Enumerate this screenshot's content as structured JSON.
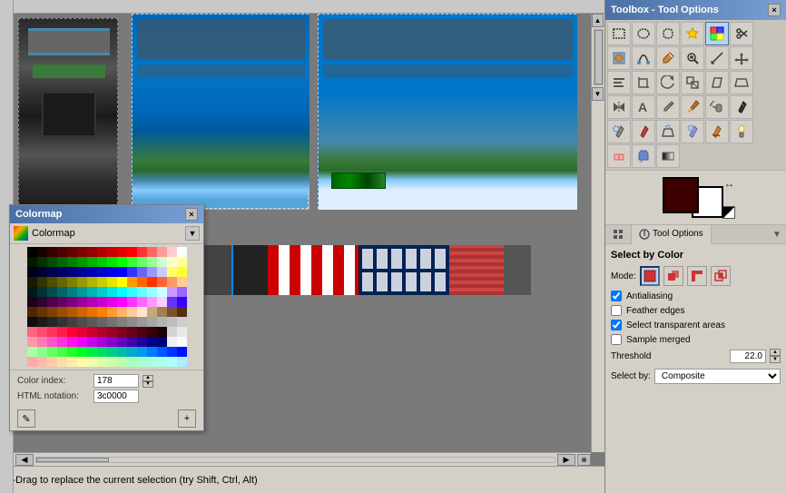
{
  "toolbox": {
    "title": "Toolbox - Tool Options",
    "close_label": "×"
  },
  "colormap": {
    "title": "Colormap",
    "label": "Colormap",
    "close_label": "×",
    "color_index_label": "Color index:",
    "color_index_value": "178",
    "html_notation_label": "HTML notation:",
    "html_notation_value": "3c0000"
  },
  "tool_options": {
    "section_title": "Select by Color",
    "mode_label": "Mode:",
    "antialiasing_label": "Antialiasing",
    "antialiasing_checked": true,
    "feather_edges_label": "Feather edges",
    "feather_edges_checked": false,
    "select_transparent_label": "Select transparent areas",
    "select_transparent_checked": true,
    "sample_merged_label": "Sample merged",
    "sample_merged_checked": false,
    "threshold_label": "Threshold",
    "threshold_value": "22.0",
    "select_by_label": "Select by:",
    "select_by_value": "Composite"
  },
  "tabs": {
    "tool_options_label": "Tool Options"
  },
  "status_bar": {
    "text": "k-Drag to replace the current selection (try Shift, Ctrl, Alt)"
  },
  "tools": [
    {
      "name": "rect-select",
      "icon": "⬜"
    },
    {
      "name": "ellipse-select",
      "icon": "⭕"
    },
    {
      "name": "lasso-select",
      "icon": "🪢"
    },
    {
      "name": "fuzzy-select",
      "icon": "🔮"
    },
    {
      "name": "select-by-color",
      "icon": "🎨"
    },
    {
      "name": "scissors-select",
      "icon": "✂"
    },
    {
      "name": "foreground-select",
      "icon": "👤"
    },
    {
      "name": "paths",
      "icon": "🖊"
    },
    {
      "name": "color-picker",
      "icon": "💉"
    },
    {
      "name": "zoom",
      "icon": "🔍"
    },
    {
      "name": "measure",
      "icon": "📏"
    },
    {
      "name": "move",
      "icon": "✛"
    },
    {
      "name": "alignment",
      "icon": "⊞"
    },
    {
      "name": "crop",
      "icon": "⊡"
    },
    {
      "name": "rotate",
      "icon": "↻"
    },
    {
      "name": "scale",
      "icon": "⇲"
    },
    {
      "name": "shear",
      "icon": "⊿"
    },
    {
      "name": "perspective",
      "icon": "▱"
    },
    {
      "name": "flip",
      "icon": "⇌"
    },
    {
      "name": "text",
      "icon": "A"
    },
    {
      "name": "pencil",
      "icon": "✏"
    },
    {
      "name": "paintbrush",
      "icon": "🖌"
    },
    {
      "name": "airbrush",
      "icon": "🌬"
    },
    {
      "name": "ink",
      "icon": "✒"
    },
    {
      "name": "clone",
      "icon": "⊕"
    },
    {
      "name": "healing",
      "icon": "✚"
    },
    {
      "name": "perspective-clone",
      "icon": "▤"
    },
    {
      "name": "blur-sharpen",
      "icon": "◎"
    },
    {
      "name": "smudge",
      "icon": "~"
    },
    {
      "name": "dodge-burn",
      "icon": "◑"
    },
    {
      "name": "eraser",
      "icon": "◻"
    },
    {
      "name": "bucket-fill",
      "icon": "🪣"
    },
    {
      "name": "blend",
      "icon": "◈"
    },
    {
      "name": "free-select",
      "icon": "🌟"
    }
  ],
  "mode_buttons": [
    {
      "name": "mode-replace",
      "active": true
    },
    {
      "name": "mode-add",
      "active": false
    },
    {
      "name": "mode-subtract",
      "active": false
    },
    {
      "name": "mode-intersect",
      "active": false
    }
  ],
  "colors": {
    "accent": "#4a6fa5",
    "fg_color": "#3c0000",
    "bg_color": "#ffffff"
  }
}
